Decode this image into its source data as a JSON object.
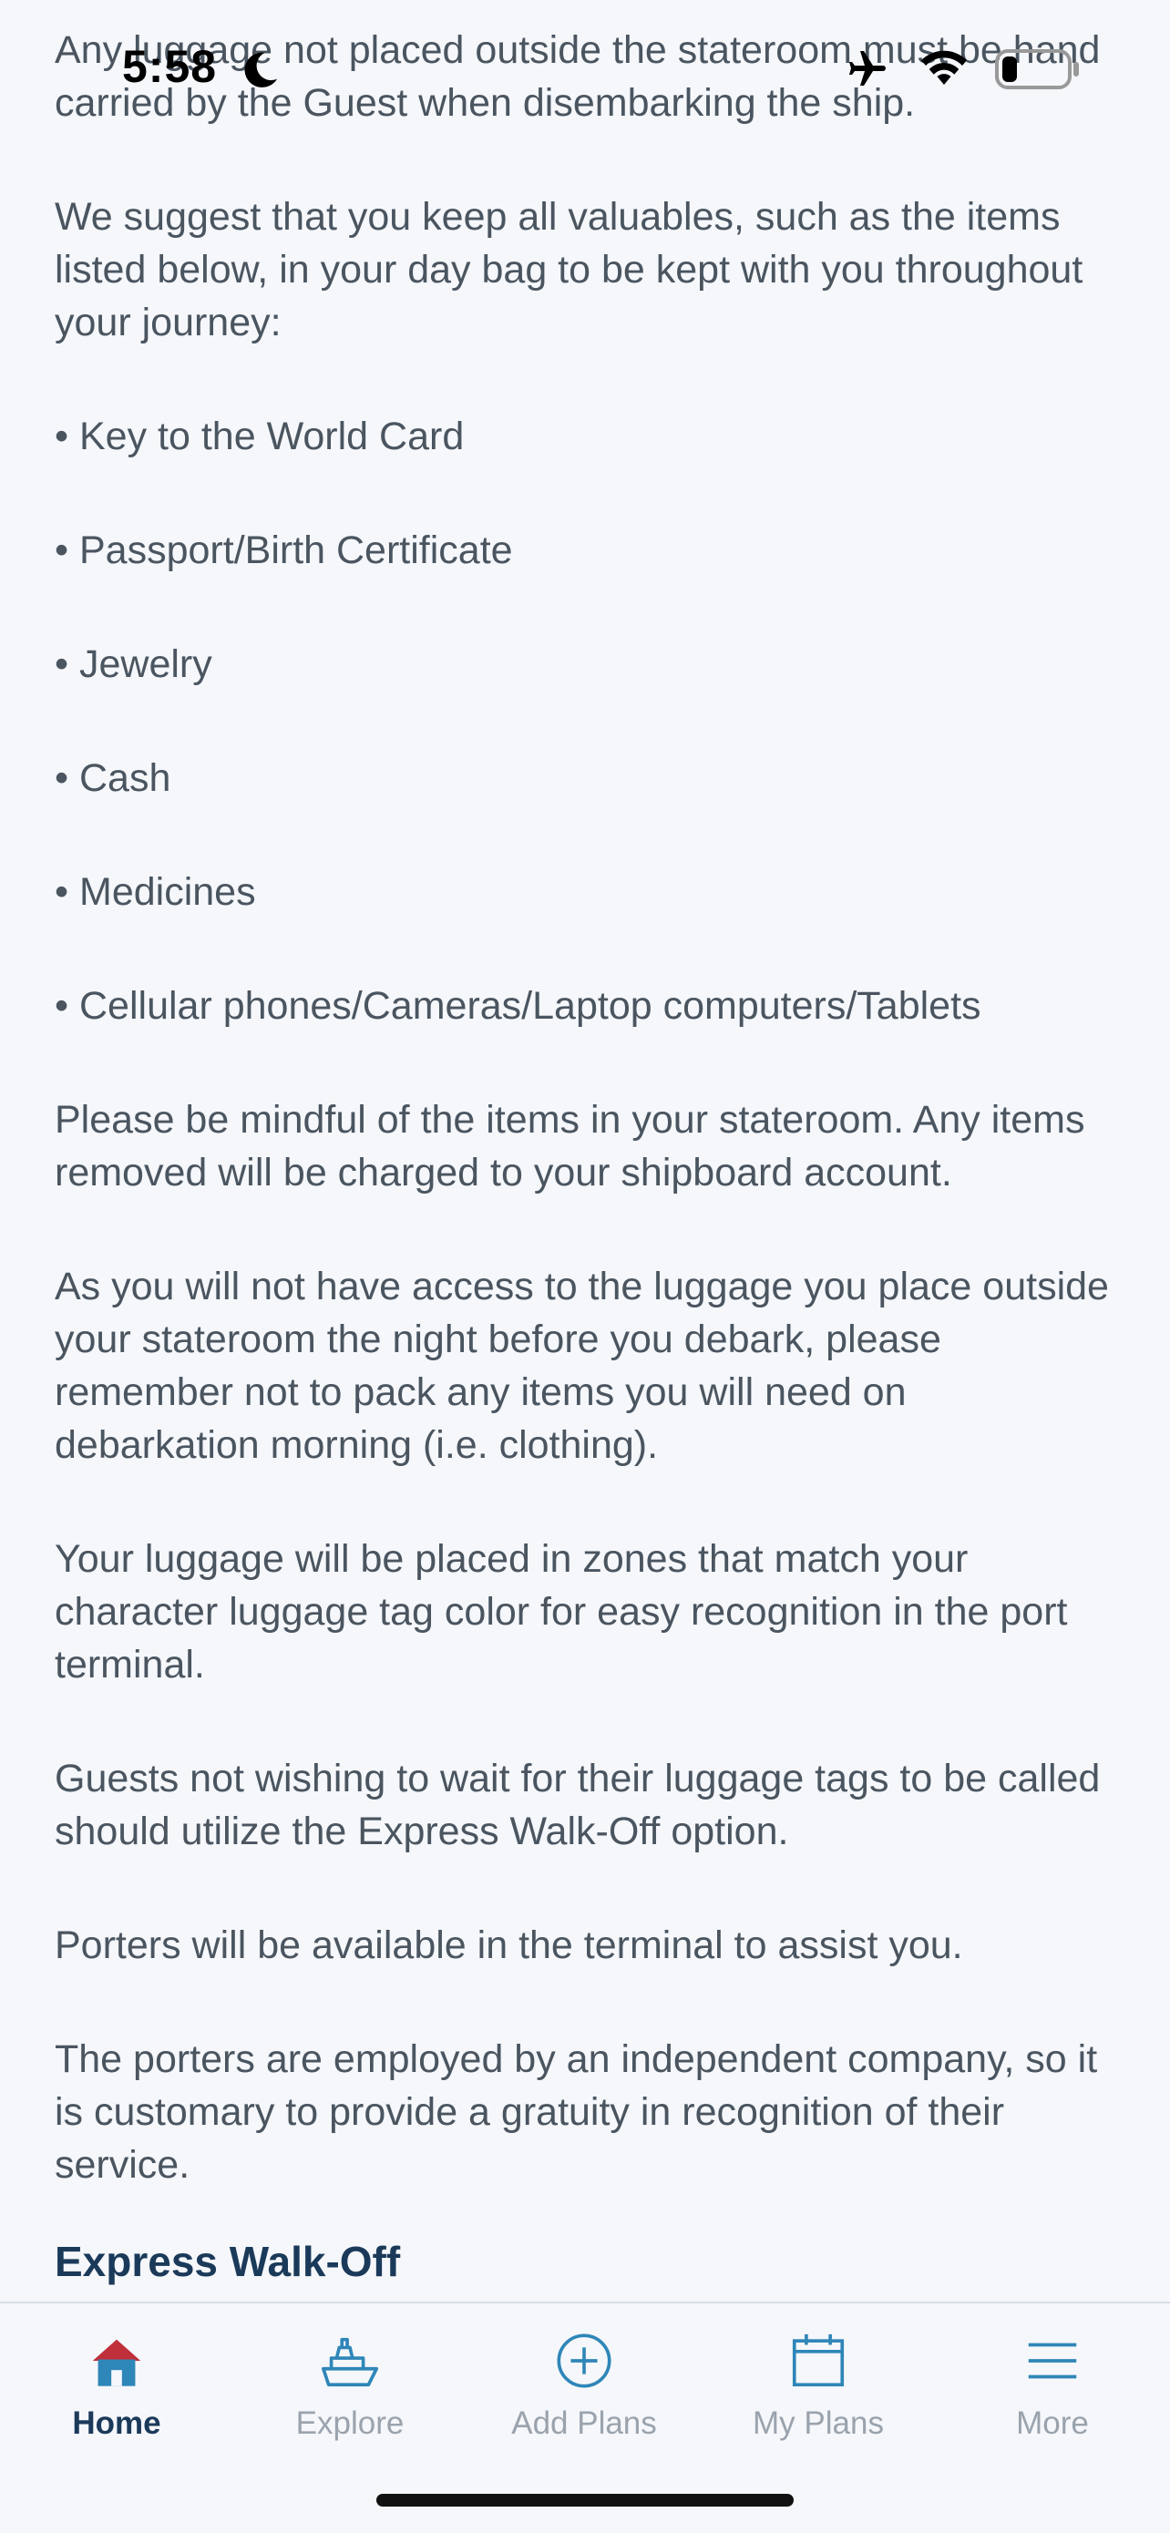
{
  "status_bar": {
    "time": "5:58"
  },
  "content": {
    "intro_lines": "Any luggage not placed outside the stateroom must be hand carried by the Guest when disembarking the ship.",
    "suggest": "We suggest that you keep all valuables, such as the items listed below, in your day bag to be kept with you throughout your journey:",
    "bullets": [
      "• Key to the World Card",
      "• Passport/Birth Certificate",
      "• Jewelry",
      "• Cash",
      "• Medicines",
      "• Cellular phones/Cameras/Laptop computers/Tablets"
    ],
    "paragraphs": [
      "Please be mindful of the items in your stateroom. Any items removed will be charged to your shipboard account.",
      "As you will not have access to the luggage you place outside your stateroom the night before you debark, please remember not to pack any items you will need on debarkation morning (i.e. clothing).",
      "Your luggage will be placed in zones that match your character luggage tag color for easy recognition in the port terminal.",
      "Guests not wishing to wait for their luggage tags to be called should utilize the Express Walk-Off option.",
      "Porters will be available in the terminal to assist you.",
      "The porters are employed by an independent company, so it is customary to provide a gratuity in recognition of their service."
    ],
    "section_heading": "Express Walk-Off"
  },
  "tabbar": {
    "tabs": [
      {
        "label": "Home",
        "icon": "home-icon",
        "active": true
      },
      {
        "label": "Explore",
        "icon": "ship-icon",
        "active": false
      },
      {
        "label": "Add Plans",
        "icon": "plus-circle-icon",
        "active": false
      },
      {
        "label": "My Plans",
        "icon": "calendar-icon",
        "active": false
      },
      {
        "label": "More",
        "icon": "menu-icon",
        "active": false
      }
    ]
  },
  "colors": {
    "background": "#f5f7fb",
    "body_text": "#4a5560",
    "heading": "#1b3a5a",
    "tab_inactive": "#9aa3ad",
    "tab_icon_blue": "#2f86b8",
    "home_roof_red": "#c0303a"
  }
}
